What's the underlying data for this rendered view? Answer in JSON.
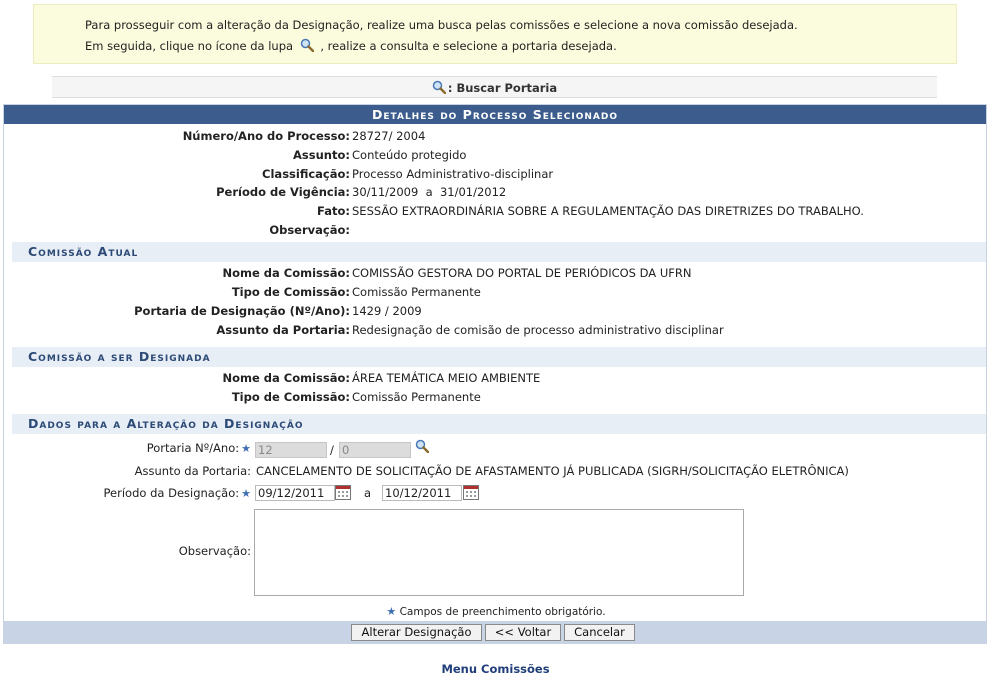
{
  "info": {
    "line1": "Para prosseguir com a alteração da Designação, realize uma busca pelas comissões e selecione a nova comissão desejada.",
    "line2_before": "Em seguida, clique no ícone da lupa",
    "line2_after": ", realize a consulta e selecione a portaria desejada."
  },
  "search_bar": {
    "label": ": Buscar Portaria"
  },
  "process": {
    "caption": "Detalhes do Processo Selecionado",
    "fields": [
      {
        "label": "Número/Ano do Processo:",
        "value": "28727/ 2004"
      },
      {
        "label": "Assunto:",
        "value": "Conteúdo protegido"
      },
      {
        "label": "Classificação:",
        "value": "Processo Administrativo-disciplinar"
      },
      {
        "label": "Período de Vigência:",
        "value": "30/11/2009  a  31/01/2012"
      },
      {
        "label": "Fato:",
        "value": "SESSÃO EXTRAORDINÁRIA SOBRE A REGULAMENTAÇÃO DAS DIRETRIZES DO TRABALHO."
      },
      {
        "label": "Observação:",
        "value": ""
      }
    ]
  },
  "current": {
    "title": "Comissão Atual",
    "fields": [
      {
        "label": "Nome da Comissão:",
        "value": "COMISSÃO GESTORA DO PORTAL DE PERIÓDICOS DA UFRN"
      },
      {
        "label": "Tipo de Comissão:",
        "value": "Comissão Permanente"
      },
      {
        "label": "Portaria de Designação (Nº/Ano):",
        "value": "1429 / 2009"
      },
      {
        "label": "Assunto da Portaria:",
        "value": "Redesignação de comisão de processo administrativo disciplinar"
      }
    ]
  },
  "new_commission": {
    "title": "Comissão a ser Designada",
    "fields": [
      {
        "label": "Nome da Comissão:",
        "value": "ÁREA TEMÁTICA MEIO AMBIENTE"
      },
      {
        "label": "Tipo de Comissão:",
        "value": "Comissão Permanente"
      }
    ]
  },
  "change": {
    "title": "Dados para a Alteração da Designação",
    "portaria_label": "Portaria Nº/Ano:",
    "portaria_number": "12",
    "portaria_year": "0",
    "slash": "/",
    "assunto_label": "Assunto da Portaria:",
    "assunto_value": "CANCELAMENTO DE SOLICITAÇÃO DE AFASTAMENTO JÁ PUBLICADA (SIGRH/SOLICITAÇÃO ELETRÔNICA)",
    "periodo_label": "Período da Designação:",
    "date_start": "09/12/2011",
    "date_sep": "a",
    "date_end": "10/12/2011",
    "obs_label": "Observação:",
    "required_mark": "★"
  },
  "footnote": "Campos de preenchimento obrigatório.",
  "buttons": {
    "alterar": "Alterar Designação",
    "voltar": "<< Voltar",
    "cancelar": "Cancelar"
  },
  "menu_link": "Menu Comissões",
  "colors": {
    "caption_bg": "#3b5c8c",
    "subhead_bg": "#e8eef6",
    "info_bg": "#fbfbdd",
    "button_bar": "#c8d4e6"
  }
}
